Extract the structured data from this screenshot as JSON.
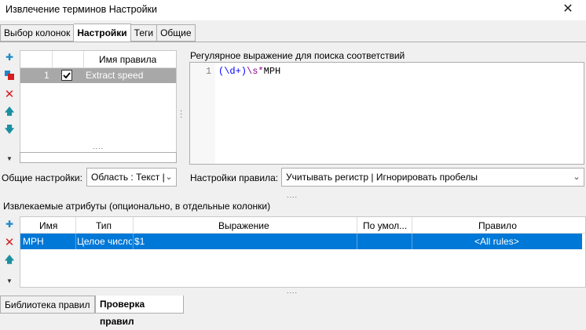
{
  "window": {
    "title": "Извлечение терминов Настройки",
    "close_glyph": "✕"
  },
  "tabs": [
    {
      "label": "Выбор колонок"
    },
    {
      "label": "Настройки",
      "active": true
    },
    {
      "label": "Теги"
    },
    {
      "label": "Общие"
    }
  ],
  "rules_panel": {
    "column_header": "Имя правила",
    "rows": [
      {
        "index": "1",
        "checked": true,
        "name": "Extract speed"
      }
    ],
    "filter_value": "",
    "grip": "....",
    "toolbar_icons": [
      "add-icon",
      "duplicate-icon",
      "delete-icon",
      "move-up-icon",
      "move-down-icon",
      "collapse-icon"
    ]
  },
  "general_settings": {
    "label": "Общие настройки:",
    "value": "Область : Текст |"
  },
  "regex_panel": {
    "label": "Регулярное выражение для поиска соответствий",
    "line_number": "1",
    "code_parts": {
      "group": "(\\d+)",
      "whitespace": "\\s*",
      "literal": "MPH"
    }
  },
  "rule_settings": {
    "label": "Настройки правила:",
    "value": "Учитывать регистр | Игнорировать пробелы"
  },
  "attributes": {
    "label": "Извлекаемые атрибуты (опционально, в отдельные колонки)",
    "columns": [
      "Имя",
      "Тип",
      "Выражение",
      "По умол...",
      "Правило"
    ],
    "rows": [
      {
        "name": "MPH",
        "type": "Целое число",
        "expression": "$1",
        "default": "",
        "rule": "<All rules>"
      }
    ]
  },
  "bottom_tabs": [
    {
      "label": "Библиотека правил"
    },
    {
      "label": "Проверка правил",
      "active": true
    }
  ],
  "colors": {
    "selection": "#0078d7",
    "rule_selected": "#a8a8a8",
    "regex_blue": "#0000ff",
    "regex_purple": "#8b008b"
  }
}
